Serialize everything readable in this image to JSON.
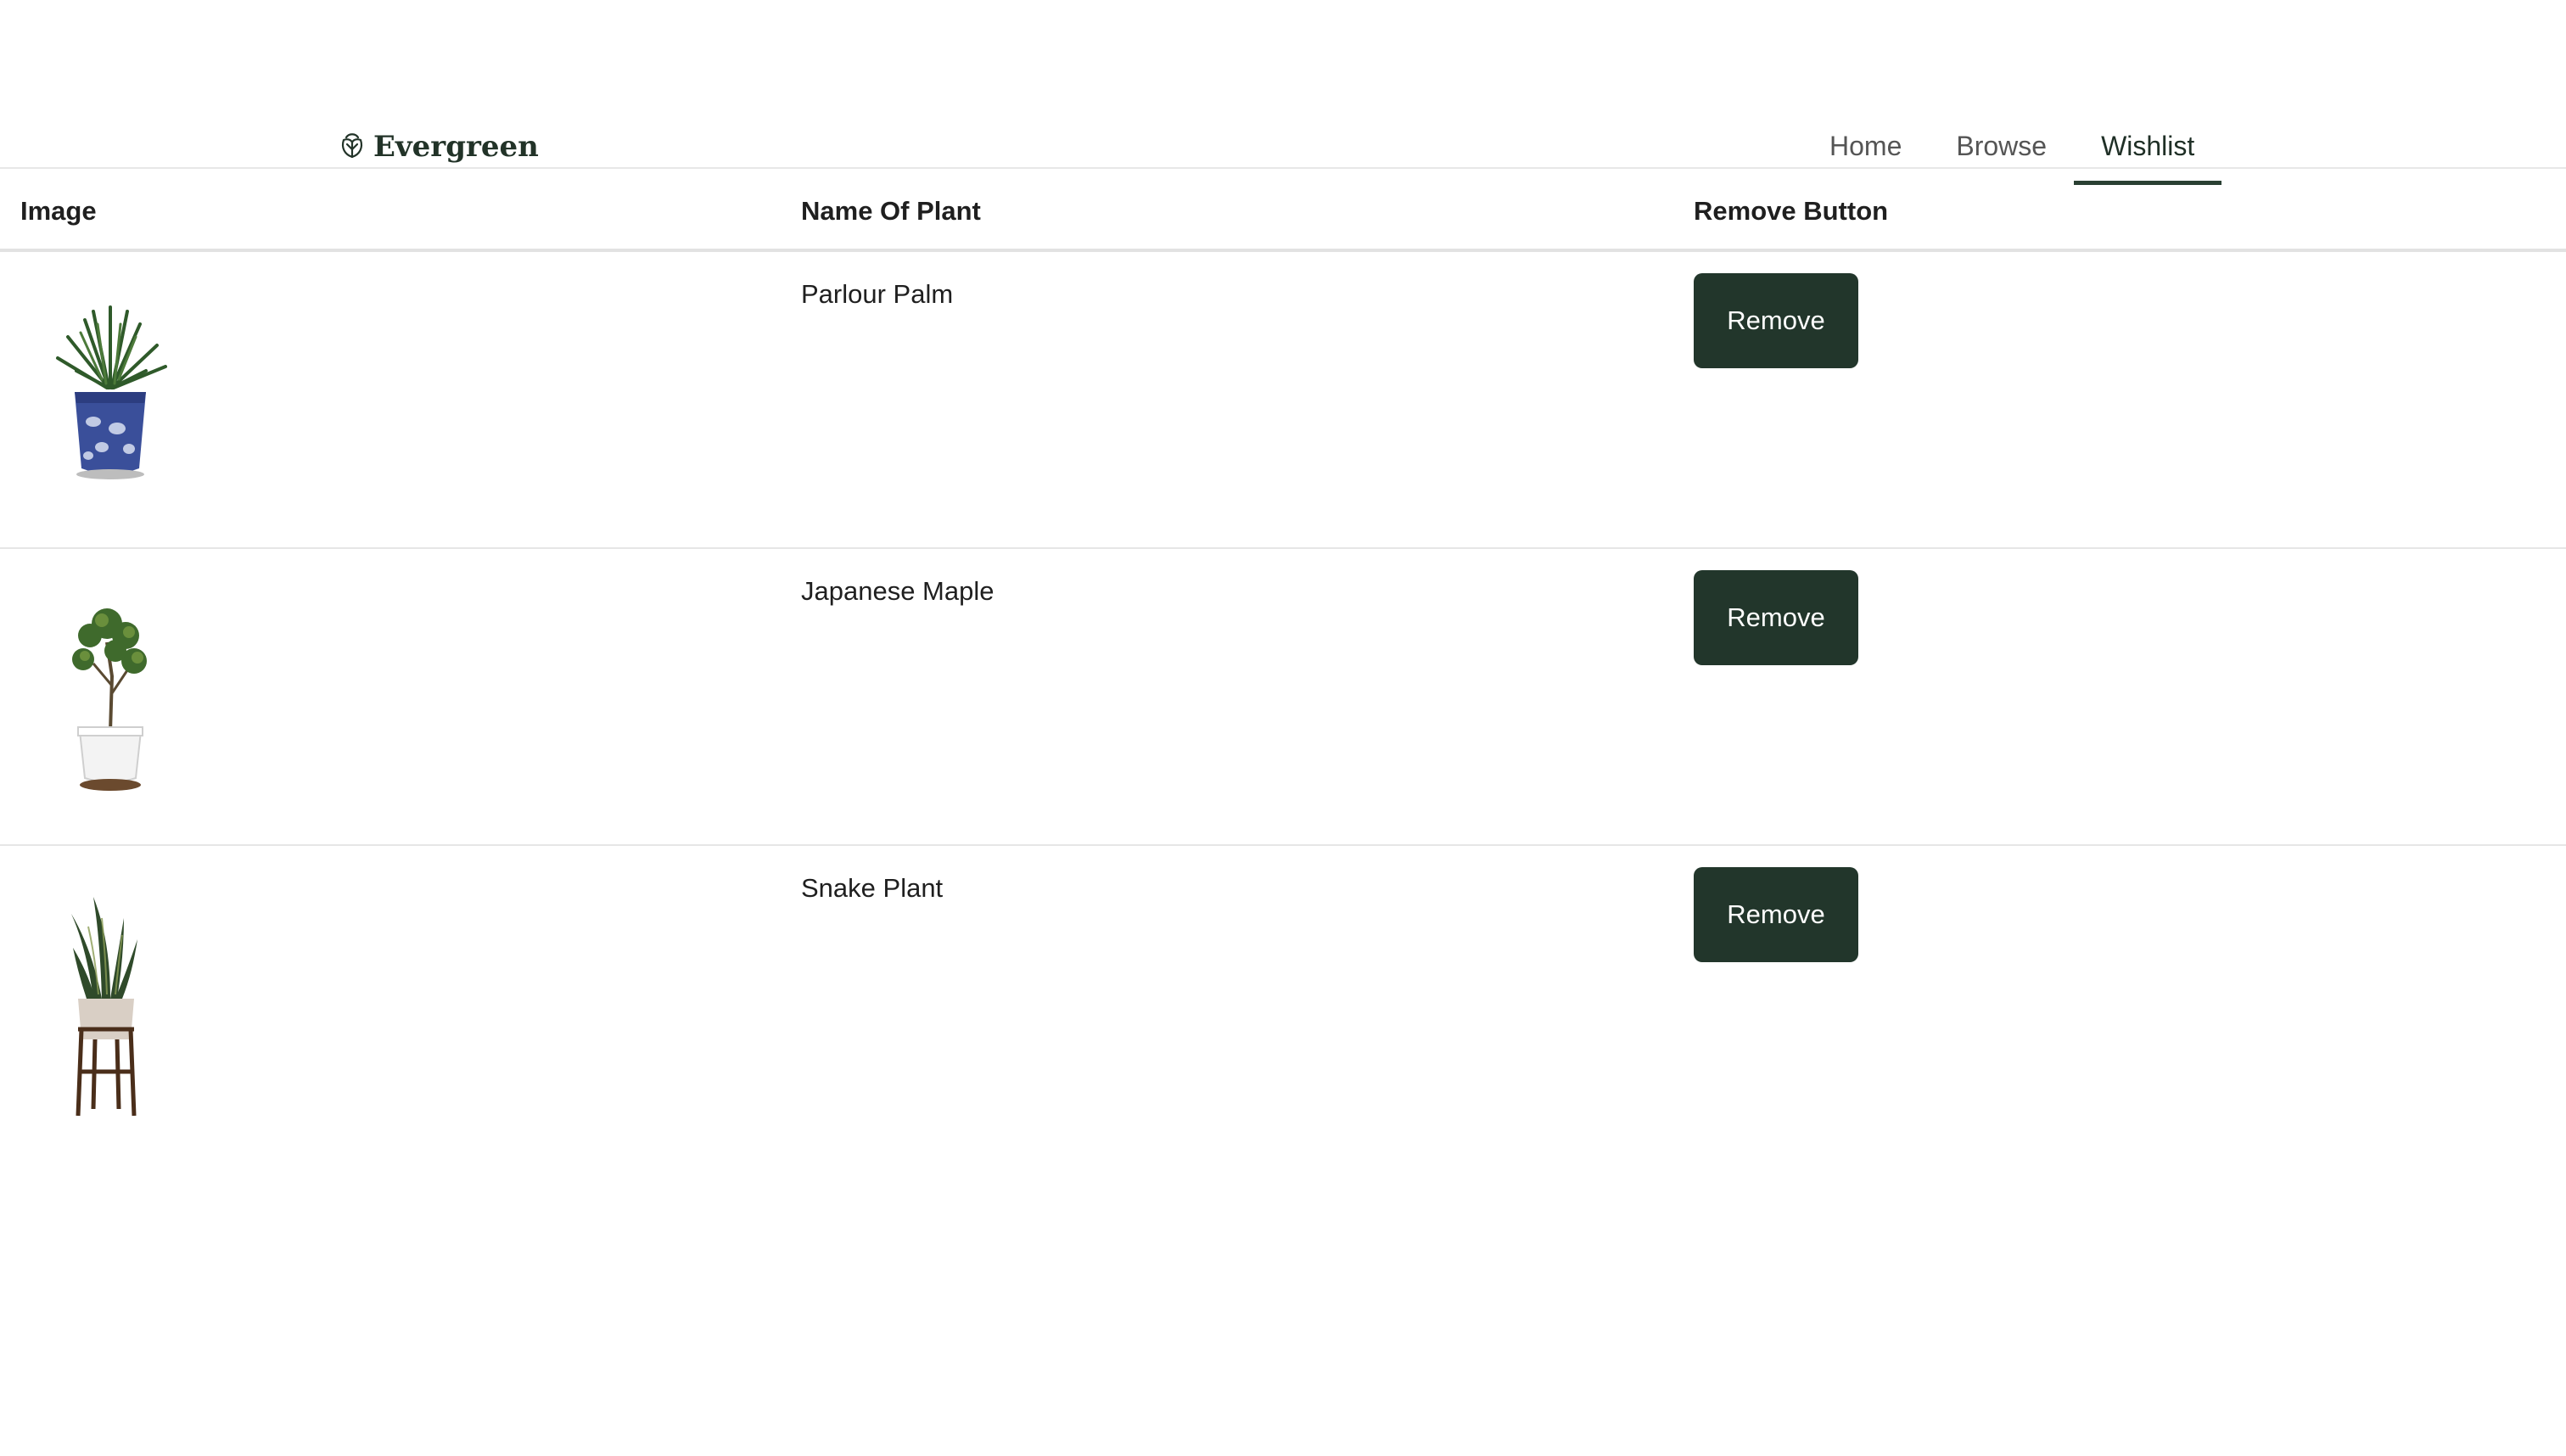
{
  "brand": {
    "name": "Evergreen",
    "logo_icon": "leaf-icon",
    "color": "#223328"
  },
  "nav": {
    "items": [
      {
        "label": "Home",
        "active": false
      },
      {
        "label": "Browse",
        "active": false
      },
      {
        "label": "Wishlist",
        "active": true
      }
    ]
  },
  "table": {
    "headers": {
      "image": "Image",
      "name": "Name Of Plant",
      "remove": "Remove Button"
    },
    "rows": [
      {
        "name": "Parlour Palm",
        "image_icon": "parlour-palm-plant-image",
        "remove_label": "Remove"
      },
      {
        "name": "Japanese Maple",
        "image_icon": "japanese-maple-plant-image",
        "remove_label": "Remove"
      },
      {
        "name": "Snake Plant",
        "image_icon": "snake-plant-image",
        "remove_label": "Remove"
      }
    ]
  },
  "colors": {
    "button_bg": "#22362b",
    "button_text": "#ffffff",
    "nav_active_underline": "#2a4033"
  }
}
